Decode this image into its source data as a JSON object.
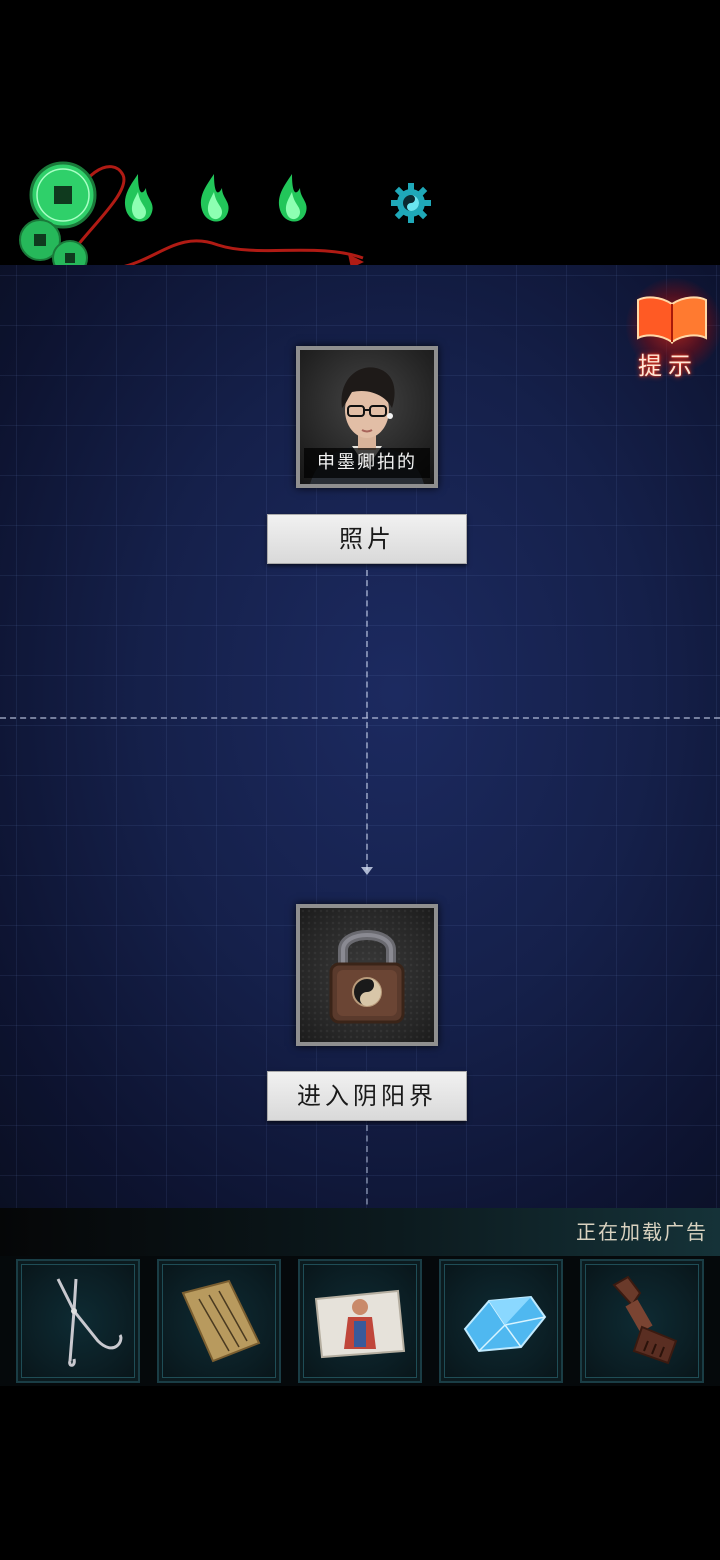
{
  "hud": {
    "coins_icon": "copper-coins-icon",
    "lives": [
      "green-flame-icon",
      "green-flame-icon",
      "green-flame-icon"
    ],
    "settings_icon": "gear-icon",
    "accent_color": "#3cff7a"
  },
  "hint": {
    "icon": "red-book-icon",
    "label": "提示"
  },
  "board": {
    "nodes": [
      {
        "caption": "申墨卿拍的",
        "label": "照片",
        "icon": "portrait-photo"
      },
      {
        "label": "进入阴阳界",
        "icon": "taiji-padlock-icon"
      }
    ]
  },
  "ad_status": "正在加载广告",
  "inventory": {
    "items": [
      {
        "icon": "tongs-icon"
      },
      {
        "icon": "talisman-scroll-icon"
      },
      {
        "icon": "paper-figure-icon"
      },
      {
        "icon": "blue-crystal-icon"
      },
      {
        "icon": "wooden-comb-icon"
      }
    ]
  }
}
